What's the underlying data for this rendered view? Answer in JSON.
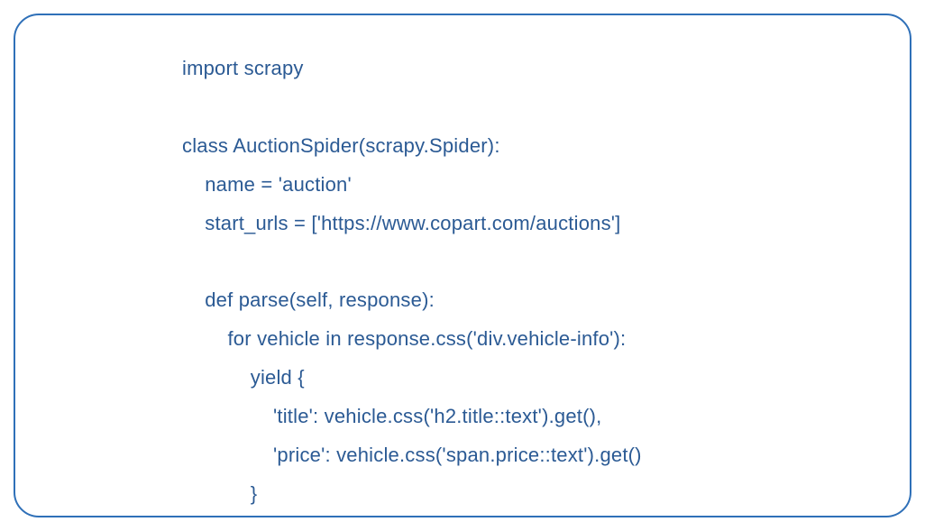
{
  "code": {
    "line1": "import scrapy",
    "line2": "",
    "line3": "class AuctionSpider(scrapy.Spider):",
    "line4": "    name = 'auction'",
    "line5": "    start_urls = ['https://www.copart.com/auctions']",
    "line6": "",
    "line7": "    def parse(self, response):",
    "line8": "        for vehicle in response.css('div.vehicle-info'):",
    "line9": "            yield {",
    "line10": "                'title': vehicle.css('h2.title::text').get(),",
    "line11": "                'price': vehicle.css('span.price::text').get()",
    "line12": "            }"
  },
  "colors": {
    "border": "#2f70b8",
    "text": "#2b5a94",
    "background": "#ffffff"
  }
}
